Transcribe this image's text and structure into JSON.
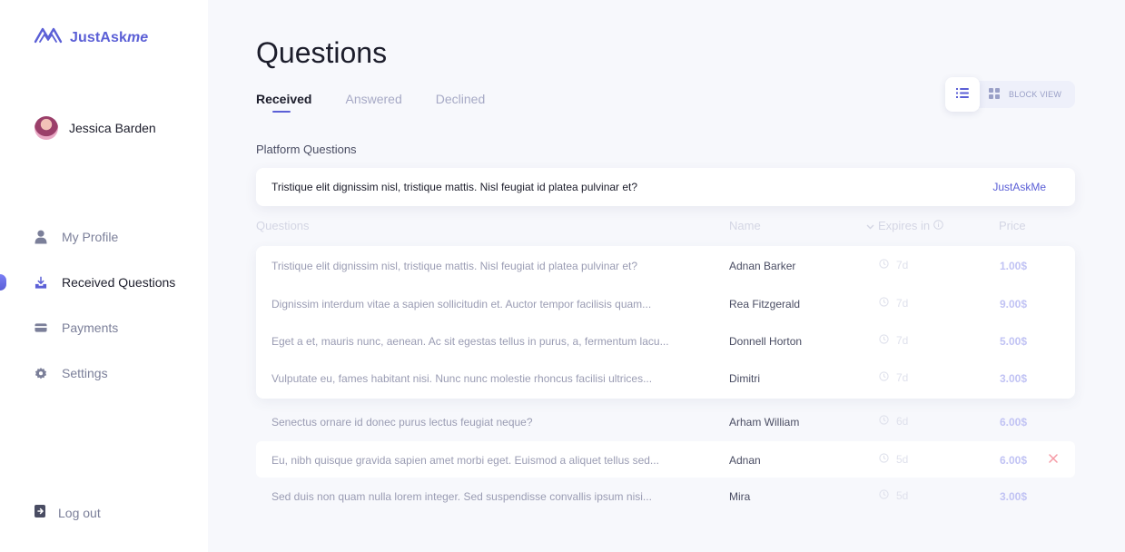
{
  "app": {
    "logo_text": "JustAsk",
    "logo_text_italic": "me",
    "brand_color": "#5b5fd6"
  },
  "user": {
    "name": "Jessica Barden",
    "avatar_icon": "user-avatar"
  },
  "nav": {
    "items": [
      {
        "label": "My Profile",
        "icon": "user-icon",
        "active": false
      },
      {
        "label": "Received Questions",
        "icon": "inbox-download-icon",
        "active": true
      },
      {
        "label": "Payments",
        "icon": "credit-card-icon",
        "active": false
      },
      {
        "label": "Settings",
        "icon": "gear-icon",
        "active": false
      }
    ],
    "logout": "Log out"
  },
  "page": {
    "title": "Questions",
    "tabs": [
      {
        "label": "Received",
        "active": true
      },
      {
        "label": "Answered",
        "active": false
      },
      {
        "label": "Declined",
        "active": false
      }
    ],
    "view_toggle": {
      "list_icon": "list-icon",
      "block_icon": "grid-icon",
      "block_label": "BLOCK VIEW"
    }
  },
  "platform": {
    "label": "Platform Questions",
    "question": "Tristique elit dignissim nisl, tristique mattis. Nisl feugiat id platea pulvinar et?",
    "source": "JustAskMe"
  },
  "table": {
    "headers": {
      "question": "Questions",
      "name": "Name",
      "expires": "Expires in",
      "price": "Price"
    },
    "rows": [
      {
        "question": "Tristique elit dignissim nisl, tristique mattis. Nisl feugiat id platea pulvinar et?",
        "name": "Adnan Barker",
        "expires": "7d",
        "price": "1.00$"
      },
      {
        "question": "Dignissim interdum vitae a sapien sollicitudin et. Auctor tempor facilisis quam...",
        "name": "Rea Fitzgerald",
        "expires": "7d",
        "price": "9.00$"
      },
      {
        "question": "Eget a et, mauris nunc, aenean. Ac sit egestas tellus in purus, a, fermentum lacu...",
        "name": "Donnell Horton",
        "expires": "7d",
        "price": "5.00$"
      },
      {
        "question": "Vulputate eu, fames habitant nisi. Nunc nunc molestie rhoncus facilisi ultrices...",
        "name": "Dimitri",
        "expires": "7d",
        "price": "3.00$"
      },
      {
        "question": "Senectus ornare id donec purus lectus feugiat neque?",
        "name": "Arham William",
        "expires": "6d",
        "price": "6.00$"
      },
      {
        "question": "Eu, nibh quisque gravida sapien amet morbi eget. Euismod a aliquet tellus sed...",
        "name": "Adnan",
        "expires": "5d",
        "price": "6.00$"
      },
      {
        "question": "Sed duis non quam nulla lorem integer. Sed suspendisse convallis ipsum nisi...",
        "name": "Mira",
        "expires": "5d",
        "price": "3.00$"
      }
    ]
  }
}
